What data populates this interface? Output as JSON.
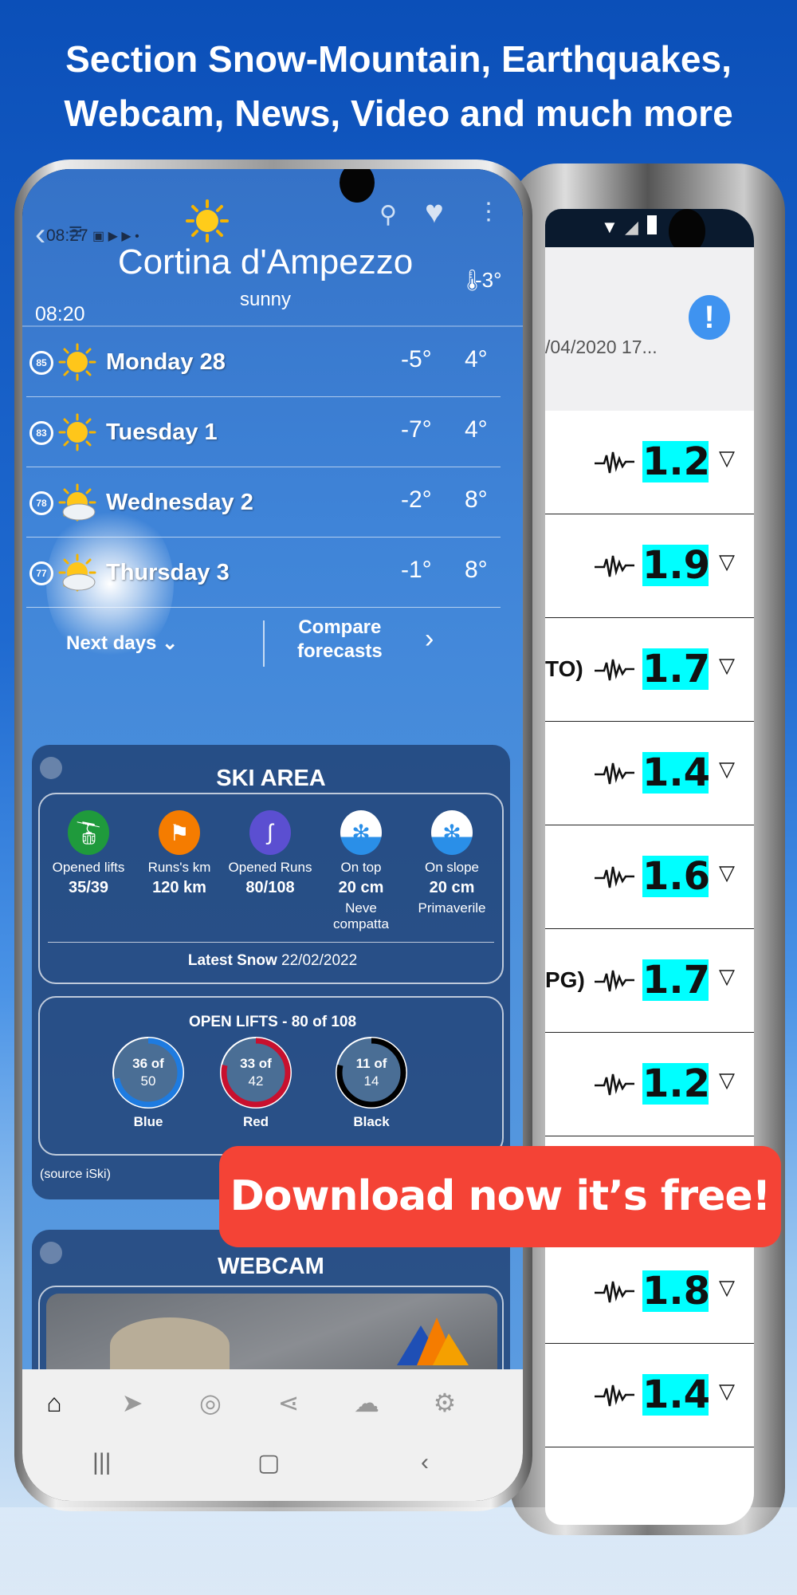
{
  "headline": {
    "line1": "Section Snow-Mountain, Earthquakes,",
    "line2": "Webcam, News, Video and much more"
  },
  "back_phone": {
    "date_fragment": "/04/2020 17...",
    "alert_icon": "exclamation-icon",
    "alert_glyph": "!",
    "rows": [
      {
        "fragment": "",
        "magnitude": "1.2"
      },
      {
        "fragment": "",
        "magnitude": "1.9"
      },
      {
        "fragment": "TO)",
        "magnitude": "1.7"
      },
      {
        "fragment": "",
        "magnitude": "1.4"
      },
      {
        "fragment": "",
        "magnitude": "1.6"
      },
      {
        "fragment": "PG)",
        "magnitude": "1.7"
      },
      {
        "fragment": "",
        "magnitude": "1.2"
      },
      {
        "fragment": "",
        "magnitude": ""
      },
      {
        "fragment": "",
        "magnitude": "1.8"
      },
      {
        "fragment": "",
        "magnitude": "1.4"
      }
    ],
    "magnitude_color": "#00ffff"
  },
  "front_phone": {
    "status_time": "08:27",
    "city": "Cortina d'Ampezzo",
    "condition": "sunny",
    "updated_time": "08:20",
    "current_temp": "-3°",
    "forecast": [
      {
        "score": "85",
        "day": "Monday 28",
        "min": "-5°",
        "max": "4°",
        "icon": "sun"
      },
      {
        "score": "83",
        "day": "Tuesday 1",
        "min": "-7°",
        "max": "4°",
        "icon": "sun"
      },
      {
        "score": "78",
        "day": "Wednesday 2",
        "min": "-2°",
        "max": "8°",
        "icon": "sun-cloud"
      },
      {
        "score": "77",
        "day": "Thursday 3",
        "min": "-1°",
        "max": "8°",
        "icon": "sun-cloud"
      }
    ],
    "next_days": "Next days",
    "compare_line1": "Compare",
    "compare_line2": "forecasts",
    "ski_area": {
      "title": "SKI AREA",
      "stats": [
        {
          "label": "Opened lifts",
          "value": "35/39",
          "sub": "",
          "color": "#1f9a3c"
        },
        {
          "label": "Runs's km",
          "value": "120 km",
          "sub": "",
          "color": "#f57c00"
        },
        {
          "label": "Opened Runs",
          "value": "80/108",
          "sub": "",
          "color": "#5b4fd1"
        },
        {
          "label": "On top",
          "value": "20 cm",
          "sub": "Neve compatta",
          "color": "#2a8fe8"
        },
        {
          "label": "On slope",
          "value": "20 cm",
          "sub": "Primaverile",
          "color": "#2a8fe8"
        }
      ],
      "latest_snow_label": "Latest Snow",
      "latest_snow_date": "22/02/2022",
      "open_lifts_title": "OPEN LIFTS - 80 of 108",
      "rings": [
        {
          "open": 36,
          "total": 50,
          "text1": "36 of",
          "text2": "50",
          "label": "Blue",
          "color": "#1e7be0"
        },
        {
          "open": 33,
          "total": 42,
          "text1": "33 of",
          "text2": "42",
          "label": "Red",
          "color": "#c8102e"
        },
        {
          "open": 11,
          "total": 14,
          "text1": "11 of",
          "text2": "14",
          "label": "Black",
          "color": "#000000"
        }
      ],
      "source": "(source iSki)"
    },
    "webcam": {
      "title": "WEBCAM"
    },
    "bottom_nav": [
      "home-icon",
      "location-arrow-icon",
      "radar-icon",
      "share-icon",
      "cloud-chat-icon",
      "gear-icon"
    ]
  },
  "download_banner": "Download now it’s free!",
  "colors": {
    "banner": "#f44336",
    "accent_blue": "#3f93f0"
  }
}
